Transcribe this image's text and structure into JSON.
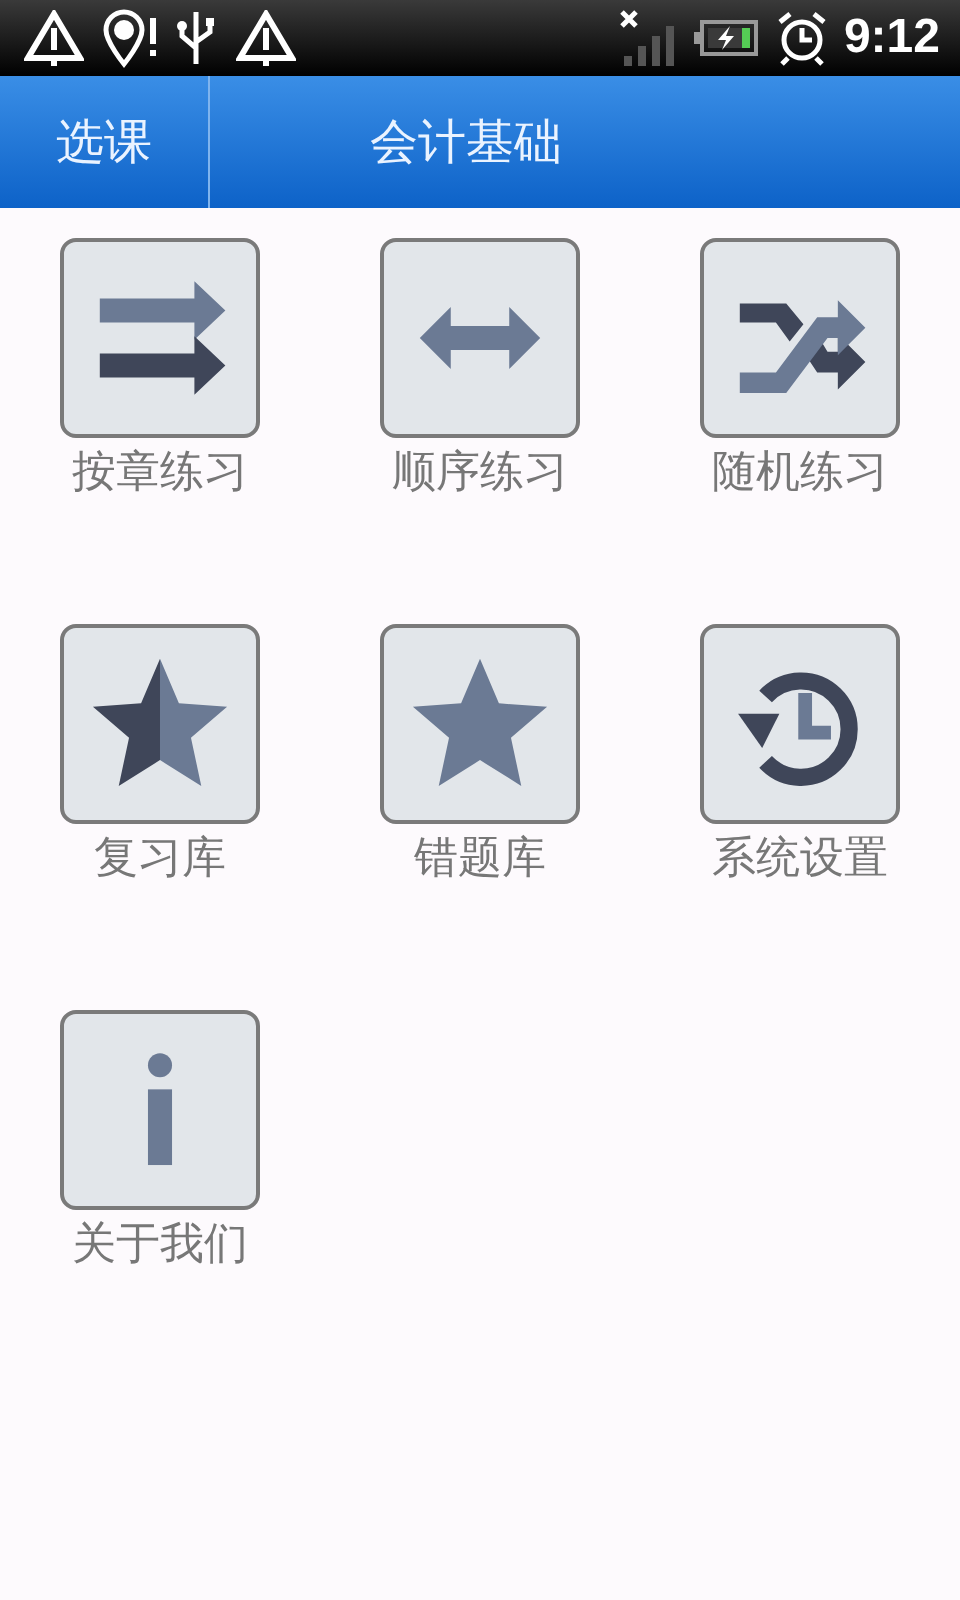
{
  "status_bar": {
    "time": "9:12"
  },
  "header": {
    "back_button": "选课",
    "title": "会计基础"
  },
  "tiles": [
    {
      "label": "按章练习",
      "kind": "arrows-right"
    },
    {
      "label": "顺序练习",
      "kind": "double-arrow"
    },
    {
      "label": "随机练习",
      "kind": "shuffle"
    },
    {
      "label": "复习库",
      "kind": "star-half"
    },
    {
      "label": "错题库",
      "kind": "star"
    },
    {
      "label": "系统设置",
      "kind": "history"
    },
    {
      "label": "关于我们",
      "kind": "info"
    }
  ]
}
